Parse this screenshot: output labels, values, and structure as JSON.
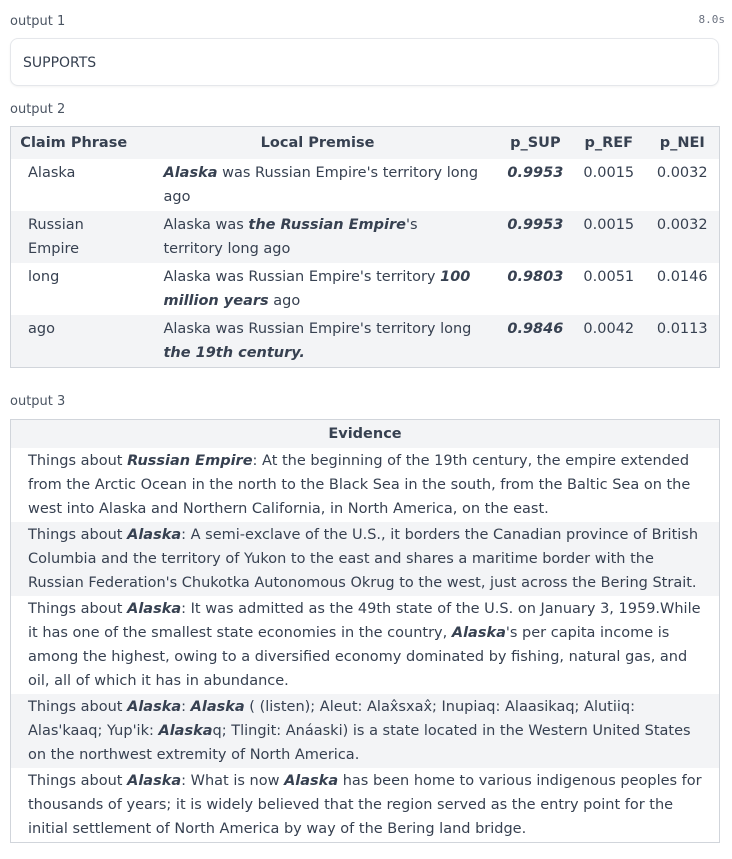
{
  "output1": {
    "label": "output 1",
    "timer": "8.0s",
    "value": "SUPPORTS"
  },
  "output2": {
    "label": "output 2",
    "headers": {
      "claim_phrase": "Claim Phrase",
      "local_premise": "Local Premise",
      "p_sup": "p_SUP",
      "p_ref": "p_REF",
      "p_nei": "p_NEI"
    },
    "rows": [
      {
        "claim_phrase": "Alaska",
        "premise_before": "",
        "premise_emph": "Alaska",
        "premise_after": " was Russian Empire's territory long ago",
        "p_sup": "0.9953",
        "p_ref": "0.0015",
        "p_nei": "0.0032"
      },
      {
        "claim_phrase": "Russian Empire",
        "premise_before": "Alaska was ",
        "premise_emph": "the Russian Empire",
        "premise_after": "'s territory long ago",
        "p_sup": "0.9953",
        "p_ref": "0.0015",
        "p_nei": "0.0032"
      },
      {
        "claim_phrase": "long",
        "premise_before": "Alaska was Russian Empire's territory ",
        "premise_emph": "100 million years",
        "premise_after": " ago",
        "p_sup": "0.9803",
        "p_ref": "0.0051",
        "p_nei": "0.0146"
      },
      {
        "claim_phrase": "ago",
        "premise_before": "Alaska was Russian Empire's territory long ",
        "premise_emph": "the 19th century.",
        "premise_after": "",
        "p_sup": "0.9846",
        "p_ref": "0.0042",
        "p_nei": "0.0113"
      }
    ]
  },
  "output3": {
    "label": "output 3",
    "header": "Evidence",
    "rows": [
      {
        "prefix": "Things about ",
        "topic": "Russian Empire",
        "parts": [
          {
            "t": ": At the beginning of the 19th century, the empire extended from the Arctic Ocean in the north to the Black Sea in the south, from the Baltic Sea on the west into Alaska and Northern California, in North America, on the east.",
            "e": false
          }
        ]
      },
      {
        "prefix": "Things about ",
        "topic": "Alaska",
        "parts": [
          {
            "t": ": A semi-exclave of the U.S., it borders the Canadian province of British Columbia and the territory of Yukon to the east and shares a maritime border with the Russian Federation's Chukotka Autonomous Okrug to the west, just across the Bering Strait.",
            "e": false
          }
        ]
      },
      {
        "prefix": "Things about ",
        "topic": "Alaska",
        "parts": [
          {
            "t": ": It was admitted as the 49th state of the U.S. on January 3, 1959.While it has one of the smallest state economies in the country, ",
            "e": false
          },
          {
            "t": "Alaska",
            "e": true
          },
          {
            "t": "'s per capita income is among the highest, owing to a diversified economy dominated by fishing, natural gas, and oil, all of which it has in abundance.",
            "e": false
          }
        ]
      },
      {
        "prefix": "Things about ",
        "topic": "Alaska",
        "parts": [
          {
            "t": ": ",
            "e": false
          },
          {
            "t": "Alaska",
            "e": true
          },
          {
            "t": " ( (listen); Aleut: Alax̂sxax̂; Inupiaq: Alaasikaq; Alutiiq: Alas'kaaq; Yup'ik: ",
            "e": false
          },
          {
            "t": "Alaska",
            "e": true
          },
          {
            "t": "q; Tlingit: Anáaski) is a state located in the Western United States on the northwest extremity of North America.",
            "e": false
          }
        ]
      },
      {
        "prefix": "Things about ",
        "topic": "Alaska",
        "parts": [
          {
            "t": ": What is now ",
            "e": false
          },
          {
            "t": "Alaska",
            "e": true
          },
          {
            "t": " has been home to various indigenous peoples for thousands of years; it is widely believed that the region served as the entry point for the initial settlement of North America by way of the Bering land bridge.",
            "e": false
          }
        ]
      }
    ]
  }
}
